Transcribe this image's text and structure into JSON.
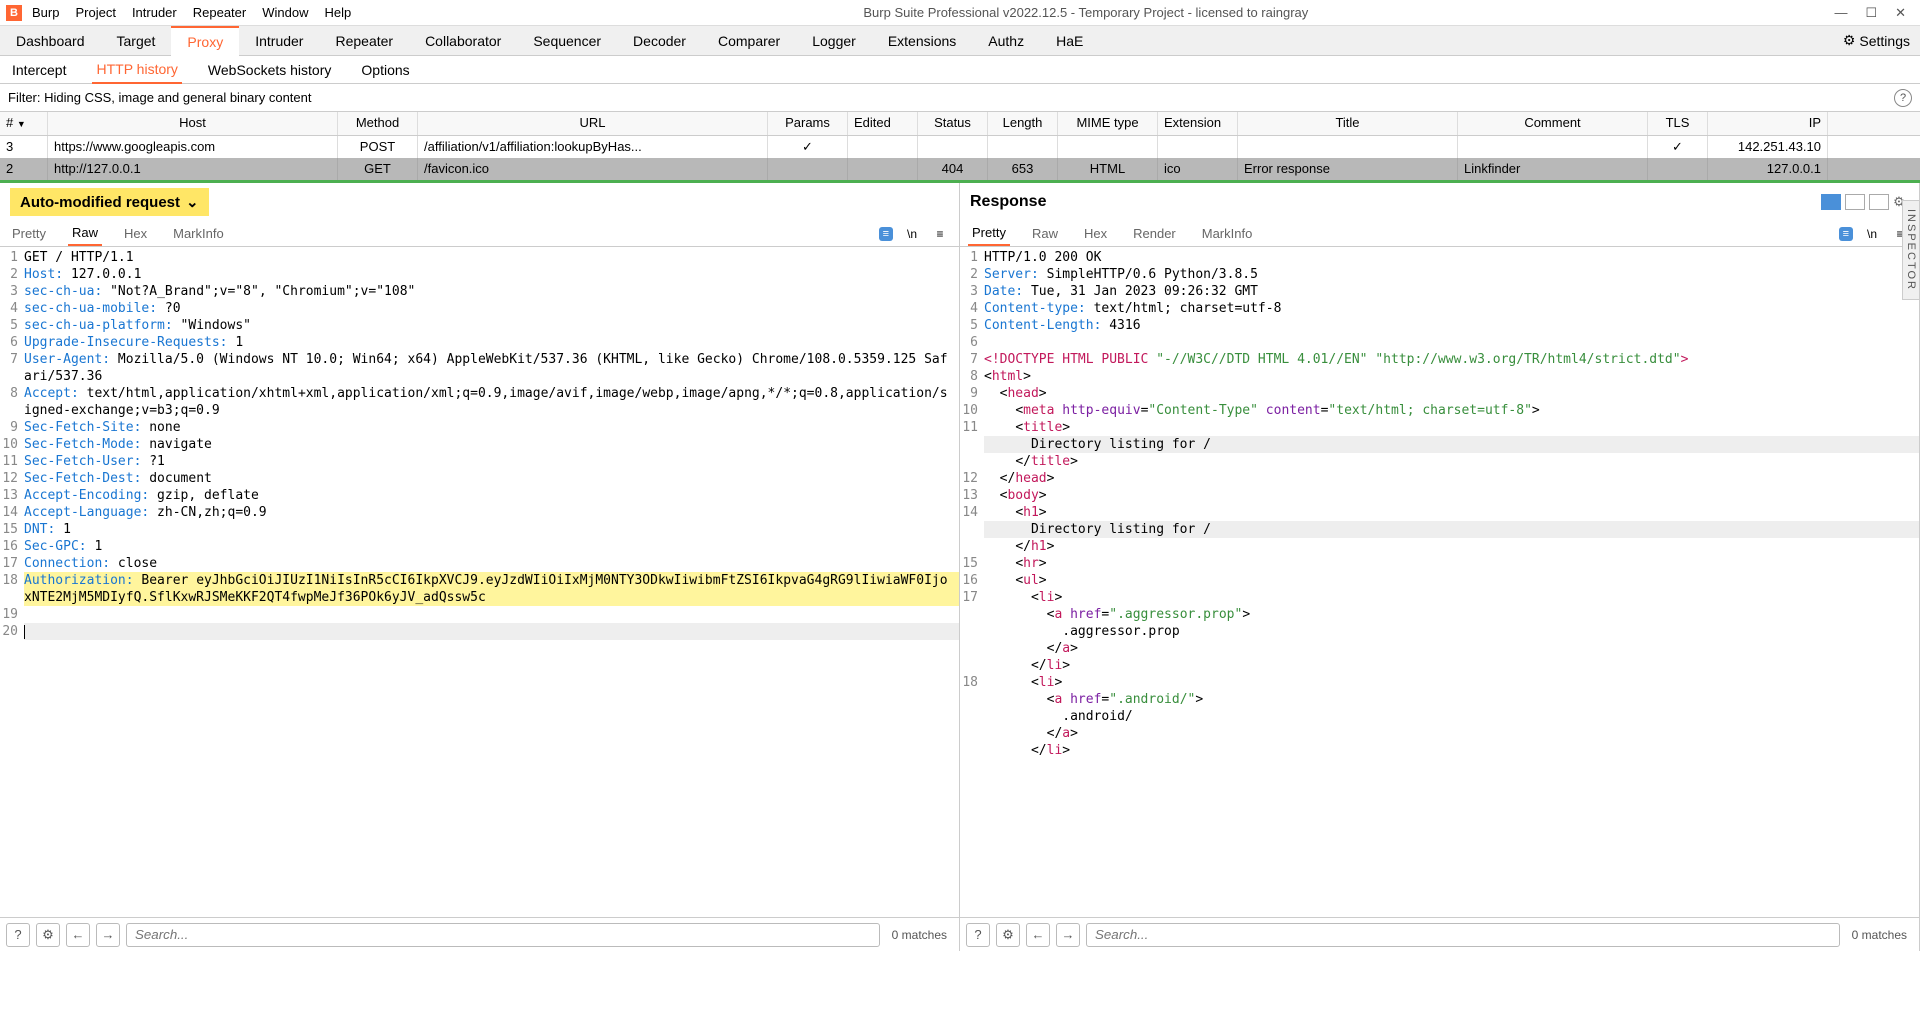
{
  "title": "Burp Suite Professional v2022.12.5 - Temporary Project - licensed to raingray",
  "menubar": [
    "Burp",
    "Project",
    "Intruder",
    "Repeater",
    "Window",
    "Help"
  ],
  "maintabs": [
    "Dashboard",
    "Target",
    "Proxy",
    "Intruder",
    "Repeater",
    "Collaborator",
    "Sequencer",
    "Decoder",
    "Comparer",
    "Logger",
    "Extensions",
    "Authz",
    "HaE"
  ],
  "settings_label": "Settings",
  "subtabs": [
    "Intercept",
    "HTTP history",
    "WebSockets history",
    "Options"
  ],
  "filter_text": "Filter: Hiding CSS, image and general binary content",
  "table_headers": {
    "num": "#",
    "host": "Host",
    "method": "Method",
    "url": "URL",
    "params": "Params",
    "edited": "Edited",
    "status": "Status",
    "length": "Length",
    "mime": "MIME type",
    "ext": "Extension",
    "title": "Title",
    "comment": "Comment",
    "tls": "TLS",
    "ip": "IP"
  },
  "rows": [
    {
      "num": "3",
      "host": "https://www.googleapis.com",
      "method": "POST",
      "url": "/affiliation/v1/affiliation:lookupByHas...",
      "params": "✓",
      "edited": "",
      "status": "",
      "length": "",
      "mime": "",
      "ext": "",
      "title": "",
      "comment": "",
      "tls": "✓",
      "ip": "142.251.43.10"
    },
    {
      "num": "2",
      "host": "http://127.0.0.1",
      "method": "GET",
      "url": "/favicon.ico",
      "params": "",
      "edited": "",
      "status": "404",
      "length": "653",
      "mime": "HTML",
      "ext": "ico",
      "title": "Error response",
      "comment": "Linkfinder",
      "tls": "",
      "ip": "127.0.0.1"
    }
  ],
  "request_title": "Auto-modified request",
  "response_title": "Response",
  "view_tabs_req": [
    "Pretty",
    "Raw",
    "Hex",
    "MarkInfo"
  ],
  "view_tabs_resp": [
    "Pretty",
    "Raw",
    "Hex",
    "Render",
    "MarkInfo"
  ],
  "search_placeholder": "Search...",
  "matches_label": "0 matches",
  "inspector_label": "INSPECTOR",
  "request_lines": [
    {
      "n": "1",
      "raw": "GET / HTTP/1.1"
    },
    {
      "n": "2",
      "key": "Host",
      "val": " 127.0.0.1"
    },
    {
      "n": "3",
      "key": "sec-ch-ua",
      "val": " \"Not?A_Brand\";v=\"8\", \"Chromium\";v=\"108\""
    },
    {
      "n": "4",
      "key": "sec-ch-ua-mobile",
      "val": " ?0"
    },
    {
      "n": "5",
      "key": "sec-ch-ua-platform",
      "val": " \"Windows\""
    },
    {
      "n": "6",
      "key": "Upgrade-Insecure-Requests",
      "val": " 1"
    },
    {
      "n": "7",
      "key": "User-Agent",
      "val": " Mozilla/5.0 (Windows NT 10.0; Win64; x64) AppleWebKit/537.36 (KHTML, like Gecko) Chrome/108.0.5359.125 Safari/537.36"
    },
    {
      "n": "8",
      "key": "Accept",
      "val": " text/html,application/xhtml+xml,application/xml;q=0.9,image/avif,image/webp,image/apng,*/*;q=0.8,application/signed-exchange;v=b3;q=0.9"
    },
    {
      "n": "9",
      "key": "Sec-Fetch-Site",
      "val": " none"
    },
    {
      "n": "10",
      "key": "Sec-Fetch-Mode",
      "val": " navigate"
    },
    {
      "n": "11",
      "key": "Sec-Fetch-User",
      "val": " ?1"
    },
    {
      "n": "12",
      "key": "Sec-Fetch-Dest",
      "val": " document"
    },
    {
      "n": "13",
      "key": "Accept-Encoding",
      "val": " gzip, deflate"
    },
    {
      "n": "14",
      "key": "Accept-Language",
      "val": " zh-CN,zh;q=0.9"
    },
    {
      "n": "15",
      "key": "DNT",
      "val": " 1"
    },
    {
      "n": "16",
      "key": "Sec-GPC",
      "val": " 1"
    },
    {
      "n": "17",
      "key": "Connection",
      "val": " close"
    },
    {
      "n": "18",
      "hl": true,
      "key": "Authorization",
      "val": " Bearer eyJhbGciOiJIUzI1NiIsInR5cCI6IkpXVCJ9.eyJzdWIiOiIxMjM0NTY3ODkwIiwibmFtZSI6IkpvaG4gRG9lIiwiaWF0IjoxNTE2MjM5MDIyfQ.SflKxwRJSMeKKF2QT4fwpMeJf36POk6yJV_adQssw5c"
    },
    {
      "n": "19",
      "raw": ""
    },
    {
      "n": "20",
      "raw": "",
      "cursor": true
    }
  ],
  "response_lines": [
    {
      "n": "1",
      "raw": "HTTP/1.0 200 OK"
    },
    {
      "n": "2",
      "key": "Server",
      "val": " SimpleHTTP/0.6 Python/3.8.5"
    },
    {
      "n": "3",
      "key": "Date",
      "val": " Tue, 31 Jan 2023 09:26:32 GMT"
    },
    {
      "n": "4",
      "key": "Content-type",
      "val": " text/html; charset=utf-8"
    },
    {
      "n": "5",
      "key": "Content-Length",
      "val": " 4316"
    },
    {
      "n": "6",
      "raw": ""
    },
    {
      "n": "7",
      "html": "<span class='hl-tag'>&lt;!DOCTYPE HTML PUBLIC </span><span class='hl-str'>\"-//W3C//DTD HTML 4.01//EN\"</span> <span class='hl-str'>\"http://www.w3.org/TR/html4/strict.dtd\"</span><span class='hl-tag'>&gt;</span>"
    },
    {
      "n": "8",
      "html": "&lt;<span class='hl-tag'>html</span>&gt;"
    },
    {
      "n": "9",
      "html": "  &lt;<span class='hl-tag'>head</span>&gt;"
    },
    {
      "n": "10",
      "html": "    &lt;<span class='hl-tag'>meta</span> <span class='hl-attr'>http-equiv</span>=<span class='hl-str'>\"Content-Type\"</span> <span class='hl-attr'>content</span>=<span class='hl-str'>\"text/html; charset=utf-8\"</span>&gt;"
    },
    {
      "n": "11",
      "html": "    &lt;<span class='hl-tag'>title</span>&gt;"
    },
    {
      "n": "",
      "html": "      Directory listing for /",
      "gray": true
    },
    {
      "n": "",
      "html": "    &lt;/<span class='hl-tag'>title</span>&gt;"
    },
    {
      "n": "12",
      "html": "  &lt;/<span class='hl-tag'>head</span>&gt;"
    },
    {
      "n": "13",
      "html": "  &lt;<span class='hl-tag'>body</span>&gt;"
    },
    {
      "n": "14",
      "html": "    &lt;<span class='hl-tag'>h1</span>&gt;"
    },
    {
      "n": "",
      "html": "      Directory listing for /",
      "gray": true
    },
    {
      "n": "",
      "html": "    &lt;/<span class='hl-tag'>h1</span>&gt;"
    },
    {
      "n": "15",
      "html": "    &lt;<span class='hl-tag'>hr</span>&gt;"
    },
    {
      "n": "16",
      "html": "    &lt;<span class='hl-tag'>ul</span>&gt;"
    },
    {
      "n": "17",
      "html": "      &lt;<span class='hl-tag'>li</span>&gt;"
    },
    {
      "n": "",
      "html": "        &lt;<span class='hl-tag'>a</span> <span class='hl-attr'>href</span>=<span class='hl-str'>\".aggressor.prop\"</span>&gt;"
    },
    {
      "n": "",
      "html": "          .aggressor.prop"
    },
    {
      "n": "",
      "html": "        &lt;/<span class='hl-tag'>a</span>&gt;"
    },
    {
      "n": "",
      "html": "      &lt;/<span class='hl-tag'>li</span>&gt;"
    },
    {
      "n": "18",
      "html": "      &lt;<span class='hl-tag'>li</span>&gt;"
    },
    {
      "n": "",
      "html": "        &lt;<span class='hl-tag'>a</span> <span class='hl-attr'>href</span>=<span class='hl-str'>\".android/\"</span>&gt;"
    },
    {
      "n": "",
      "html": "          .android/"
    },
    {
      "n": "",
      "html": "        &lt;/<span class='hl-tag'>a</span>&gt;"
    },
    {
      "n": "",
      "html": "      &lt;/<span class='hl-tag'>li</span>&gt;"
    }
  ]
}
